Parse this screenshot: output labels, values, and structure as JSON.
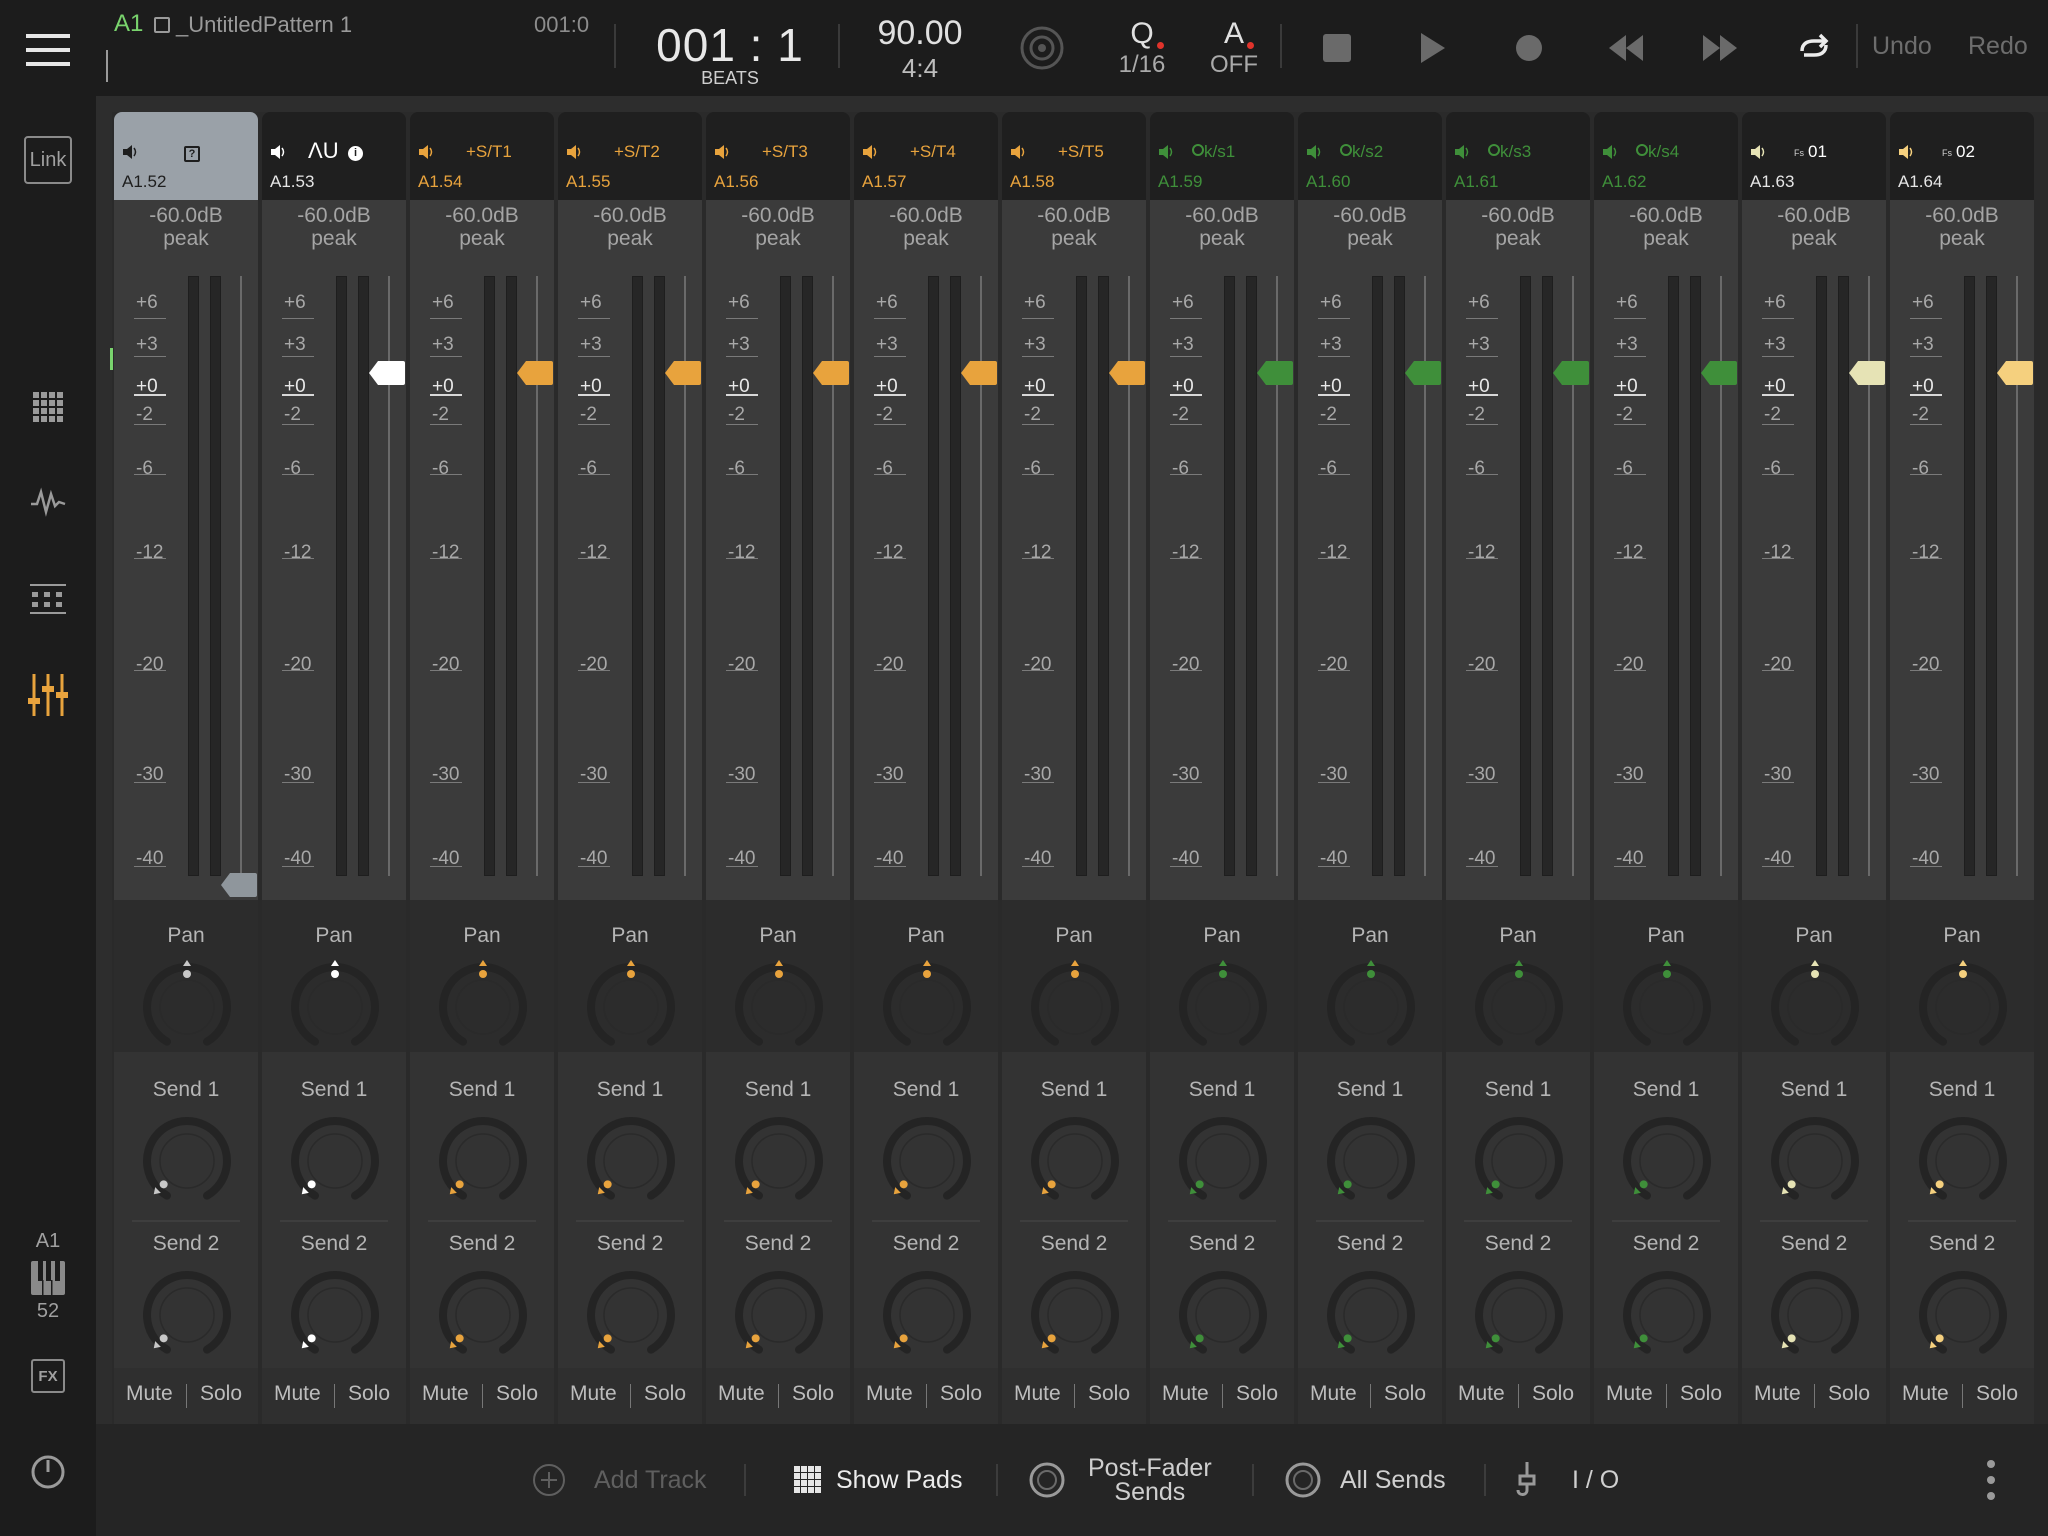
{
  "app": {
    "track_label": "A1",
    "pattern_name": "_UntitledPattern 1",
    "pattern_position": "001:0"
  },
  "transport": {
    "position": "001 : 1",
    "position_unit": "BEATS",
    "tempo": "90.00",
    "time_signature": "4:4",
    "quantize_label": "Q",
    "quantize_value": "1/16",
    "automation_label": "A",
    "automation_value": "OFF",
    "undo": "Undo",
    "redo": "Redo"
  },
  "sidebar": {
    "link_label": "Link",
    "current_track": "A1",
    "current_number": "52",
    "fx_label": "FX"
  },
  "colors": {
    "orange": "#e8a33d",
    "green": "#3f8f3a",
    "cream": "#e6e3b5",
    "white": "#ffffff",
    "gray": "#9aa1a8",
    "light_orange": "#f5d07e",
    "accent_green": "#79d36d"
  },
  "scale": [
    "+6",
    "+3",
    "+0",
    "-2",
    "-6",
    "-12",
    "-20",
    "-30",
    "-40"
  ],
  "knob_labels": {
    "pan": "Pan",
    "send1": "Send 1",
    "send2": "Send 2"
  },
  "buttons": {
    "mute": "Mute",
    "solo": "Solo"
  },
  "channels": [
    {
      "name": "",
      "id": "A1.52",
      "peak_value": "-60.0dB",
      "peak_label": "peak",
      "color": "gray",
      "selected": true,
      "fader_db": "-40",
      "icon": "unknown-plugin-icon"
    },
    {
      "name": "ΛU",
      "id": "A1.53",
      "peak_value": "-60.0dB",
      "peak_label": "peak",
      "color": "white",
      "selected": false,
      "fader_db": "+0",
      "icon": "au-info-icon"
    },
    {
      "name": "+S/T1",
      "id": "A1.54",
      "peak_value": "-60.0dB",
      "peak_label": "peak",
      "color": "orange",
      "selected": false,
      "fader_db": "+0"
    },
    {
      "name": "+S/T2",
      "id": "A1.55",
      "peak_value": "-60.0dB",
      "peak_label": "peak",
      "color": "orange",
      "selected": false,
      "fader_db": "+0"
    },
    {
      "name": "+S/T3",
      "id": "A1.56",
      "peak_value": "-60.0dB",
      "peak_label": "peak",
      "color": "orange",
      "selected": false,
      "fader_db": "+0"
    },
    {
      "name": "+S/T4",
      "id": "A1.57",
      "peak_value": "-60.0dB",
      "peak_label": "peak",
      "color": "orange",
      "selected": false,
      "fader_db": "+0"
    },
    {
      "name": "+S/T5",
      "id": "A1.58",
      "peak_value": "-60.0dB",
      "peak_label": "peak",
      "color": "orange",
      "selected": false,
      "fader_db": "+0"
    },
    {
      "name": "k/s1",
      "id": "A1.59",
      "peak_value": "-60.0dB",
      "peak_label": "peak",
      "color": "green",
      "selected": false,
      "fader_db": "+0"
    },
    {
      "name": "k/s2",
      "id": "A1.60",
      "peak_value": "-60.0dB",
      "peak_label": "peak",
      "color": "green",
      "selected": false,
      "fader_db": "+0"
    },
    {
      "name": "k/s3",
      "id": "A1.61",
      "peak_value": "-60.0dB",
      "peak_label": "peak",
      "color": "green",
      "selected": false,
      "fader_db": "+0"
    },
    {
      "name": "k/s4",
      "id": "A1.62",
      "peak_value": "-60.0dB",
      "peak_label": "peak",
      "color": "green",
      "selected": false,
      "fader_db": "+0"
    },
    {
      "name": "01",
      "id": "A1.63",
      "peak_value": "-60.0dB",
      "peak_label": "peak",
      "color": "cream",
      "selected": false,
      "fader_db": "+0"
    },
    {
      "name": "02",
      "id": "A1.64",
      "peak_value": "-60.0dB",
      "peak_label": "peak",
      "color": "light_orange",
      "selected": false,
      "fader_db": "+0"
    }
  ],
  "bottombar": {
    "add_track": "Add Track",
    "show_pads": "Show Pads",
    "post_fader_sends_1": "Post-Fader",
    "post_fader_sends_2": "Sends",
    "all_sends": "All Sends",
    "io": "I / O"
  }
}
